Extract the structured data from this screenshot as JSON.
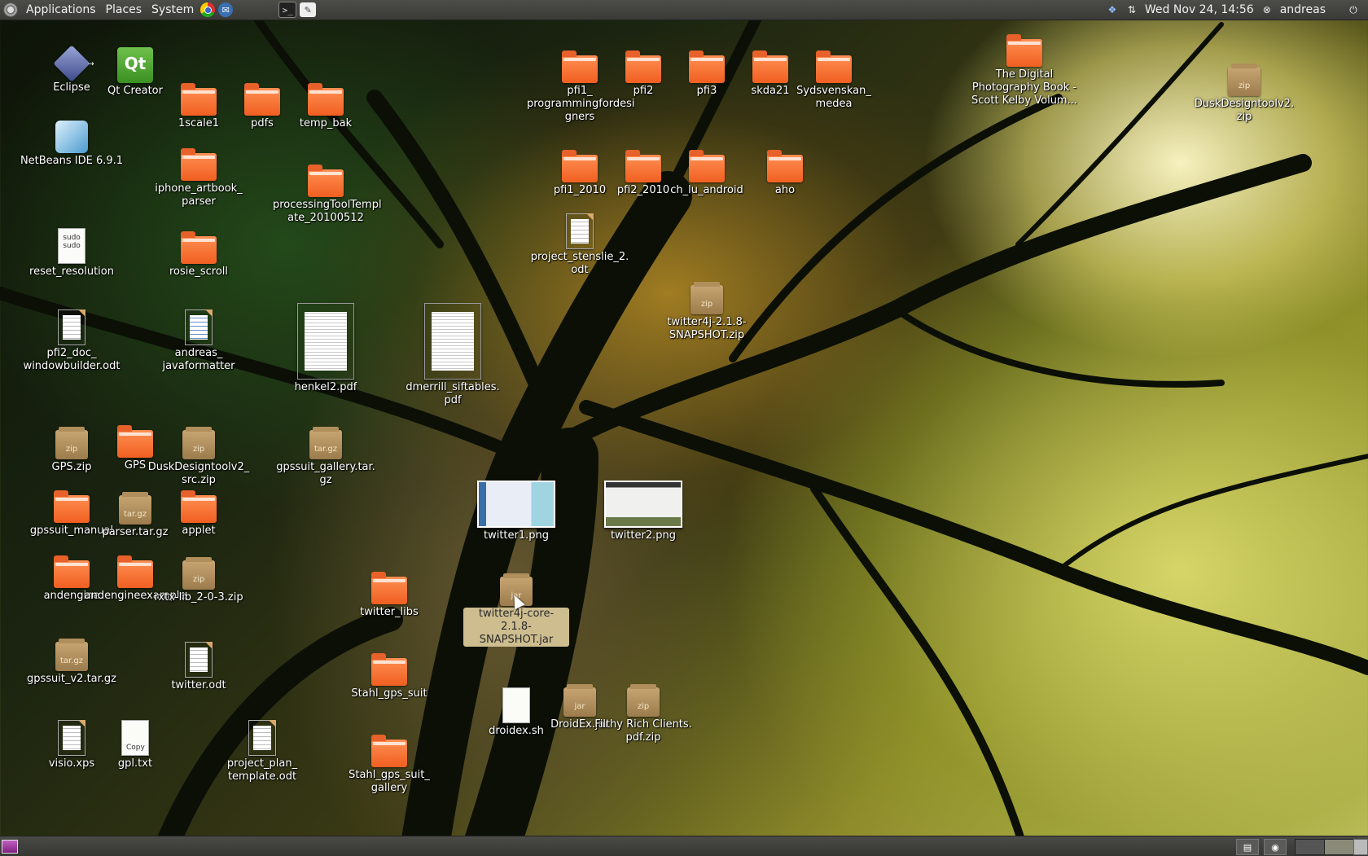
{
  "top_panel": {
    "menus": [
      "Applications",
      "Places",
      "System"
    ],
    "clock": "Wed Nov 24, 14:56",
    "user": "andreas"
  },
  "colors": {
    "panel": "#3a3a37",
    "folder": "#f05f21",
    "archive": "#9c7b4c",
    "selection": "#cdbd8f"
  },
  "desktop": {
    "icons": [
      {
        "label": "Eclipse",
        "type": "app",
        "icon": "eclipse-icon"
      },
      {
        "label": "Qt Creator",
        "type": "app",
        "icon": "qt-icon"
      },
      {
        "label": "NetBeans IDE 6.9.1",
        "type": "app",
        "icon": "netbeans-icon"
      },
      {
        "label": "1scale1",
        "type": "folder"
      },
      {
        "label": "pdfs",
        "type": "folder"
      },
      {
        "label": "temp_bak",
        "type": "folder"
      },
      {
        "label": "iphone_artbook_\nparser",
        "type": "folder"
      },
      {
        "label": "processingToolTempl\nate_20100512",
        "type": "folder"
      },
      {
        "label": "reset_resolution",
        "type": "script"
      },
      {
        "label": "rosie_scroll",
        "type": "folder"
      },
      {
        "label": "pfi2_doc_\nwindowbuilder.odt",
        "type": "document"
      },
      {
        "label": "andreas_\njavaformatter",
        "type": "document"
      },
      {
        "label": "henkel2.pdf",
        "type": "pdf"
      },
      {
        "label": "dmerrill_siftables.\npdf",
        "type": "pdf"
      },
      {
        "label": "GPS.zip",
        "type": "archive",
        "ext": "zip"
      },
      {
        "label": "GPS",
        "type": "folder"
      },
      {
        "label": "DuskDesigntoolv2_\nsrc.zip",
        "type": "archive",
        "ext": "zip"
      },
      {
        "label": "gpssuit_gallery.tar.\ngz",
        "type": "archive",
        "ext": "tar.gz"
      },
      {
        "label": "gpssuit_manual",
        "type": "folder"
      },
      {
        "label": "parser.tar.gz",
        "type": "archive",
        "ext": "tar.gz"
      },
      {
        "label": "applet",
        "type": "folder"
      },
      {
        "label": "andengine",
        "type": "folder"
      },
      {
        "label": "andengineexample",
        "type": "folder"
      },
      {
        "label": "rxtx-lib_2-0-3.zip",
        "type": "archive",
        "ext": "zip"
      },
      {
        "label": "twitter_libs",
        "type": "folder"
      },
      {
        "label": "gpssuit_v2.tar.gz",
        "type": "archive",
        "ext": "tar.gz"
      },
      {
        "label": "twitter.odt",
        "type": "document"
      },
      {
        "label": "Stahl_gps_suit",
        "type": "folder"
      },
      {
        "label": "visio.xps",
        "type": "document"
      },
      {
        "label": "gpl.txt",
        "type": "text",
        "glyph_text": "Copy"
      },
      {
        "label": "project_plan_\ntemplate.odt",
        "type": "document"
      },
      {
        "label": "Stahl_gps_suit_\ngallery",
        "type": "folder"
      },
      {
        "label": "pfi1_\nprogrammingfordesi\ngners",
        "type": "folder"
      },
      {
        "label": "pfi2",
        "type": "folder"
      },
      {
        "label": "pfi3",
        "type": "folder"
      },
      {
        "label": "skda21",
        "type": "folder"
      },
      {
        "label": "Sydsvenskan_\nmedea",
        "type": "folder"
      },
      {
        "label": "The Digital\nPhotography Book -\nScott Kelby Volum...",
        "type": "folder"
      },
      {
        "label": "DuskDesigntoolv2.\nzip",
        "type": "archive",
        "ext": "zip"
      },
      {
        "label": "pfi1_2010",
        "type": "folder"
      },
      {
        "label": "pfi2_2010",
        "type": "folder"
      },
      {
        "label": "ch_lu_android",
        "type": "folder"
      },
      {
        "label": "aho",
        "type": "folder"
      },
      {
        "label": "project_stenslie_2.\nodt",
        "type": "document"
      },
      {
        "label": "twitter4j-2.1.8-\nSNAPSHOT.zip",
        "type": "archive",
        "ext": "zip"
      },
      {
        "label": "twitter1.png",
        "type": "image"
      },
      {
        "label": "twitter2.png",
        "type": "image"
      },
      {
        "label": "twitter4j-core-2.1.8-\nSNAPSHOT.jar",
        "type": "archive",
        "ext": "jar",
        "selected": true
      },
      {
        "label": "droidex.sh",
        "type": "script"
      },
      {
        "label": "DroidEx.jar",
        "type": "archive",
        "ext": "jar"
      },
      {
        "label": "Filthy Rich Clients.\npdf.zip",
        "type": "archive",
        "ext": "zip"
      }
    ]
  },
  "script_glyph": "sudo\nsudo"
}
